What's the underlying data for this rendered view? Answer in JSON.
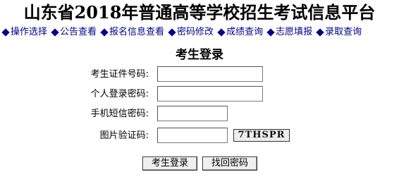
{
  "header": {
    "title": "山东省2018年普通高等学校招生考试信息平台"
  },
  "nav": {
    "icon": "diamond-icon",
    "color": "#00008b",
    "items": [
      {
        "label": "操作选择"
      },
      {
        "label": "公告查看"
      },
      {
        "label": "报名信息查看"
      },
      {
        "label": "密码修改"
      },
      {
        "label": "成绩查询"
      },
      {
        "label": "志愿填报"
      },
      {
        "label": "录取查询"
      }
    ]
  },
  "login": {
    "heading": "考生登录",
    "fields": {
      "candidate_id_label": "考生证件号码:",
      "candidate_id_value": "",
      "password_label": "个人登录密码:",
      "password_value": "",
      "sms_code_label": "手机短信密码:",
      "sms_code_value": "",
      "captcha_label": "图片验证码:",
      "captcha_value": "",
      "captcha_image_text": "7THSPR"
    },
    "buttons": {
      "login": "考生登录",
      "recover_password": "找回密码"
    }
  }
}
